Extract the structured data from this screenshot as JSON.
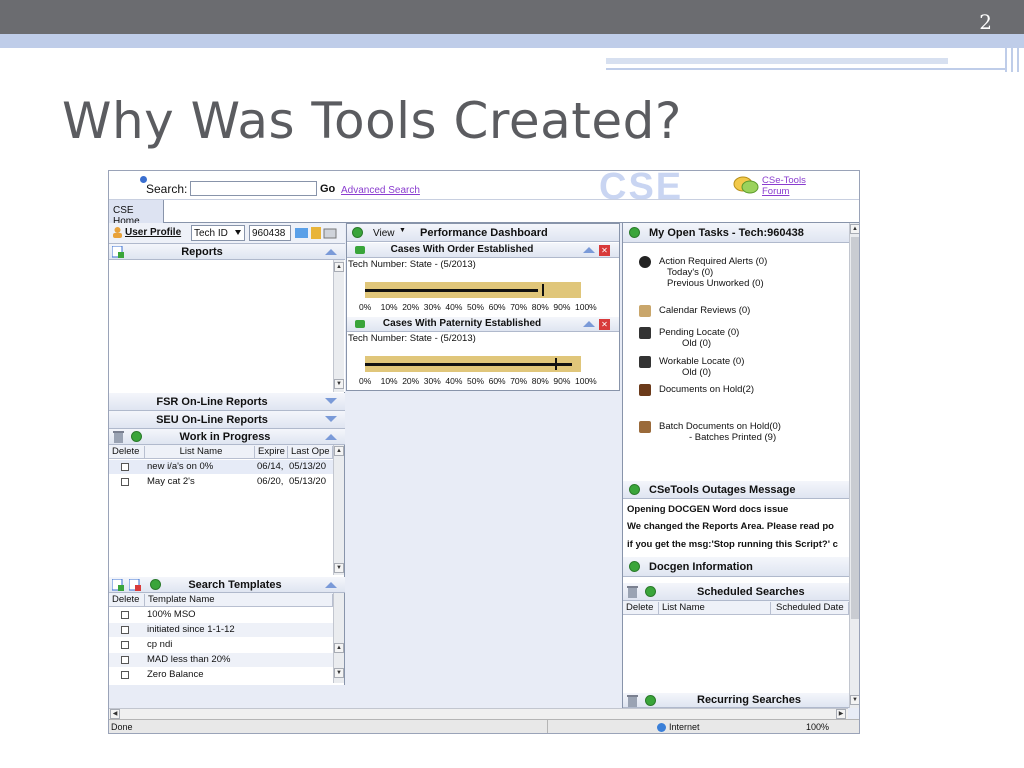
{
  "slide": {
    "number": "2",
    "title": "Why Was Tools Created?"
  },
  "app": {
    "search_label": "Search:",
    "go_label": "Go",
    "advanced_search": "Advanced Search",
    "logo_text": "CSE",
    "forum_line1": "CSe-Tools",
    "forum_line2": "Forum",
    "tab_home": "CSE Home"
  },
  "left": {
    "user_profile": "User Profile",
    "id_type": "Tech ID",
    "id_value": "960438",
    "reports_title": "Reports",
    "fsr_title": "FSR On-Line Reports",
    "seu_title": "SEU On-Line Reports",
    "wip": {
      "title": "Work in Progress",
      "columns": [
        "Delete",
        "List Name",
        "Expire",
        "Last Ope"
      ],
      "rows": [
        {
          "name": "new i/a's on 0%",
          "expire": "06/14,",
          "last": "05/13/20"
        },
        {
          "name": "May cat 2's",
          "expire": "06/20,",
          "last": "05/13/20"
        }
      ]
    },
    "templates": {
      "title": "Search Templates",
      "columns": [
        "Delete",
        "Template Name"
      ],
      "rows": [
        "100% MSO",
        "initiated since 1-1-12",
        "cp ndi",
        "MAD less than 20%",
        "Zero Balance"
      ]
    }
  },
  "middle": {
    "view_label": "View",
    "title": "Performance Dashboard",
    "gauges": [
      {
        "title": "Cases With Order Established",
        "caption": "Tech Number: State - (5/2013)",
        "value_pct": 80,
        "target_pct": 82
      },
      {
        "title": "Cases With Paternity Established",
        "caption": "Tech Number: State - (5/2013)",
        "value_pct": 96,
        "target_pct": 88
      }
    ],
    "ticks": [
      "0%",
      "10%",
      "20%",
      "30%",
      "40%",
      "50%",
      "60%",
      "70%",
      "80%",
      "90%",
      "100%"
    ]
  },
  "right": {
    "tasks_title": "My Open Tasks - Tech:960438",
    "tasks": [
      {
        "lines": [
          "Action Required Alerts (0)",
          "Today's (0)",
          "Previous Unworked (0)"
        ]
      },
      {
        "lines": [
          "Calendar Reviews (0)"
        ]
      },
      {
        "lines": [
          "Pending Locate (0)",
          "Old (0)"
        ]
      },
      {
        "lines": [
          "Workable Locate (0)",
          "Old (0)"
        ]
      },
      {
        "lines": [
          "Documents on Hold(2)"
        ]
      },
      {
        "lines": [
          "Batch Documents on Hold(0)",
          "- Batches Printed (9)"
        ]
      }
    ],
    "outages_title": "CSeTools Outages Message",
    "outages": [
      "Opening DOCGEN Word docs issue",
      "We changed the Reports Area. Please read po",
      "if you get the msg:'Stop running this Script?' c"
    ],
    "docgen_title": "Docgen Information",
    "scheduled_title": "Scheduled Searches",
    "scheduled_columns": [
      "Delete",
      "List Name",
      "Scheduled Date"
    ],
    "recurring_title": "Recurring Searches"
  },
  "status": {
    "done": "Done",
    "zone": "Internet",
    "zoom": "100%"
  }
}
